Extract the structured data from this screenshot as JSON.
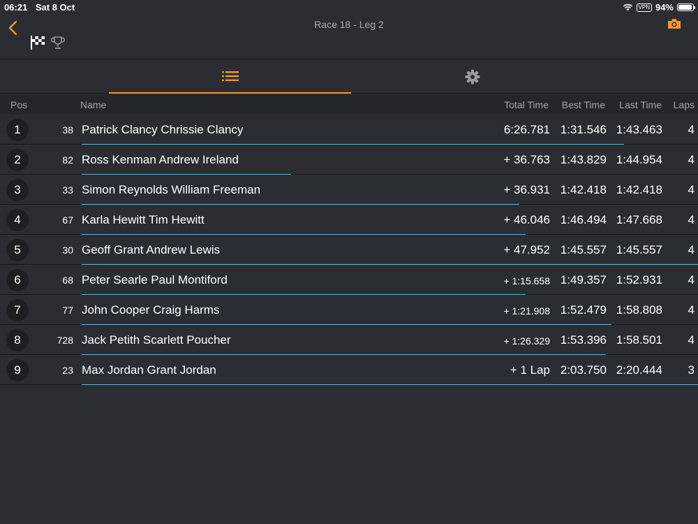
{
  "status": {
    "time": "06:21",
    "date": "Sat 8 Oct",
    "vpn": "VPN",
    "battery": "94%",
    "battery_level": 0.94
  },
  "header": {
    "title": "Race 18  -  Leg 2"
  },
  "icons": {
    "back": "chevron-left-icon",
    "flag": "checkered-flag-icon",
    "trophy": "trophy-icon",
    "camera": "camera-icon",
    "list": "list-icon",
    "settings": "gear-icon"
  },
  "colors": {
    "accent": "#f19a2a",
    "progress": "#5bb8d8",
    "background": "#2b2d33"
  },
  "table": {
    "headers": {
      "pos": "Pos",
      "name": "Name",
      "total": "Total Time",
      "best": "Best Time",
      "last": "Last Time",
      "laps": "Laps"
    },
    "rows": [
      {
        "pos": "1",
        "car": "38",
        "name": "Patrick Clancy Chrissie Clancy",
        "total": "6:26.781",
        "best": "1:31.546",
        "last": "1:43.463",
        "laps": "4",
        "progress": 0.88
      },
      {
        "pos": "2",
        "car": "82",
        "name": "Ross Kenman Andrew Ireland",
        "total": "+ 36.763",
        "best": "1:43.829",
        "last": "1:44.954",
        "laps": "4",
        "progress": 0.34
      },
      {
        "pos": "3",
        "car": "33",
        "name": "Simon Reynolds William Freeman",
        "total": "+ 36.931",
        "best": "1:42.418",
        "last": "1:42.418",
        "laps": "4",
        "progress": 0.71
      },
      {
        "pos": "4",
        "car": "67",
        "name": "Karla Hewitt Tim Hewitt",
        "total": "+ 46.046",
        "best": "1:46.494",
        "last": "1:47.668",
        "laps": "4",
        "progress": 0.72
      },
      {
        "pos": "5",
        "car": "30",
        "name": "Geoff Grant Andrew Lewis",
        "total": "+ 47.952",
        "best": "1:45.557",
        "last": "1:45.557",
        "laps": "4",
        "progress": 1.0
      },
      {
        "pos": "6",
        "car": "68",
        "name": "Peter Searle Paul Montiford",
        "total": "+ 1:15.658",
        "best": "1:49.357",
        "last": "1:52.931",
        "laps": "4",
        "progress": 0.72
      },
      {
        "pos": "7",
        "car": "77",
        "name": "John Cooper Craig Harms",
        "total": "+ 1:21.908",
        "best": "1:52.479",
        "last": "1:58.808",
        "laps": "4",
        "progress": 0.86
      },
      {
        "pos": "8",
        "car": "728",
        "name": "Jack Petith Scarlett Poucher",
        "total": "+ 1:26.329",
        "best": "1:53.396",
        "last": "1:58.501",
        "laps": "4",
        "progress": 0.85
      },
      {
        "pos": "9",
        "car": "23",
        "name": "Max Jordan Grant Jordan",
        "total": "+ 1 Lap",
        "best": "2:03.750",
        "last": "2:20.444",
        "laps": "3",
        "progress": 1.0
      }
    ]
  }
}
